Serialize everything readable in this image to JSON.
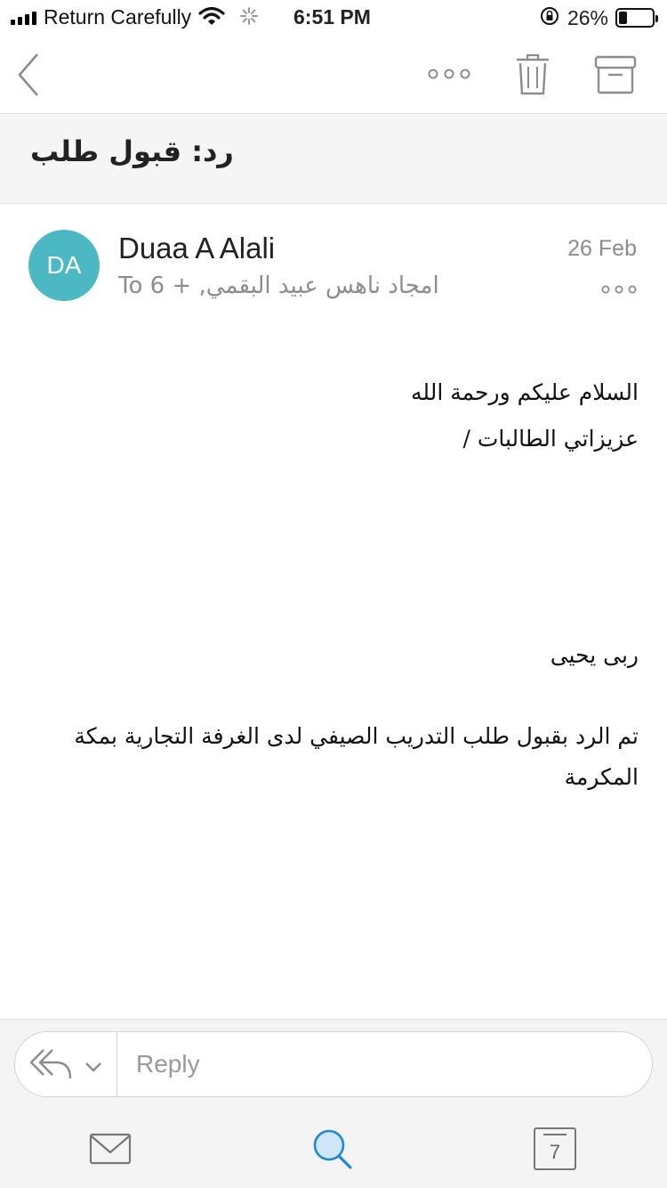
{
  "status_bar": {
    "carrier": "Return Carefully",
    "time": "6:51 PM",
    "battery_percent": "26%",
    "battery_level": 0.26,
    "icons": [
      "signal-icon",
      "wifi-icon",
      "activity-spinner-icon",
      "orientation-lock-icon",
      "battery-icon"
    ]
  },
  "toolbar": {
    "icons": [
      "back-chevron-icon",
      "more-icon",
      "trash-icon",
      "archive-icon"
    ]
  },
  "email": {
    "subject": "رد: قبول طلب",
    "avatar_initials": "DA",
    "avatar_color": "#4cb8c4",
    "sender": "Duaa A Alali",
    "recipients": "To امجاد ناهس عبيد البقمي, + 6",
    "date": "26 Feb",
    "body": {
      "line1": "السلام عليكم ورحمة الله",
      "line2": "عزيزاتي الطالبات /",
      "name": "ربى يحيى",
      "message": "تم الرد بقبول طلب التدريب الصيفي لدى الغرفة التجارية بمكة المكرمة"
    }
  },
  "reply_bar": {
    "placeholder": "Reply",
    "icons": [
      "reply-all-icon",
      "chevron-down-icon"
    ]
  },
  "tab_bar": {
    "calendar_day": "7",
    "accent_color": "#1e88d8",
    "icons": [
      "mail-icon",
      "search-icon",
      "calendar-icon"
    ]
  }
}
